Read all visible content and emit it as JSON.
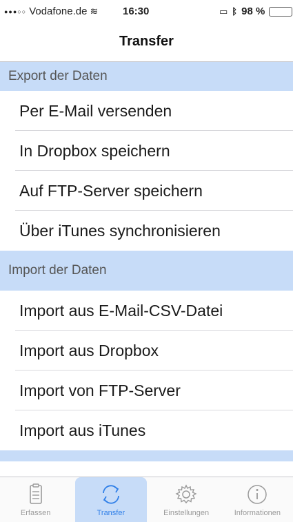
{
  "status_bar": {
    "carrier": "Vodafone.de",
    "time": "16:30",
    "battery": "98 %",
    "battery_level": 0.98
  },
  "nav": {
    "title": "Transfer"
  },
  "sections": [
    {
      "header": "Export der Daten",
      "items": [
        "Per E-Mail versenden",
        "In Dropbox speichern",
        "Auf FTP-Server speichern",
        "Über iTunes synchronisieren"
      ]
    },
    {
      "header": "Import der Daten",
      "items": [
        "Import aus E-Mail-CSV-Datei",
        "Import aus Dropbox",
        "Import von FTP-Server",
        "Import aus iTunes"
      ]
    }
  ],
  "tabbar": {
    "tabs": [
      {
        "label": "Erfassen",
        "icon": "clipboard-icon"
      },
      {
        "label": "Transfer",
        "icon": "sync-icon",
        "active": true
      },
      {
        "label": "Einstellungen",
        "icon": "gear-icon"
      },
      {
        "label": "Informationen",
        "icon": "info-icon"
      }
    ]
  }
}
